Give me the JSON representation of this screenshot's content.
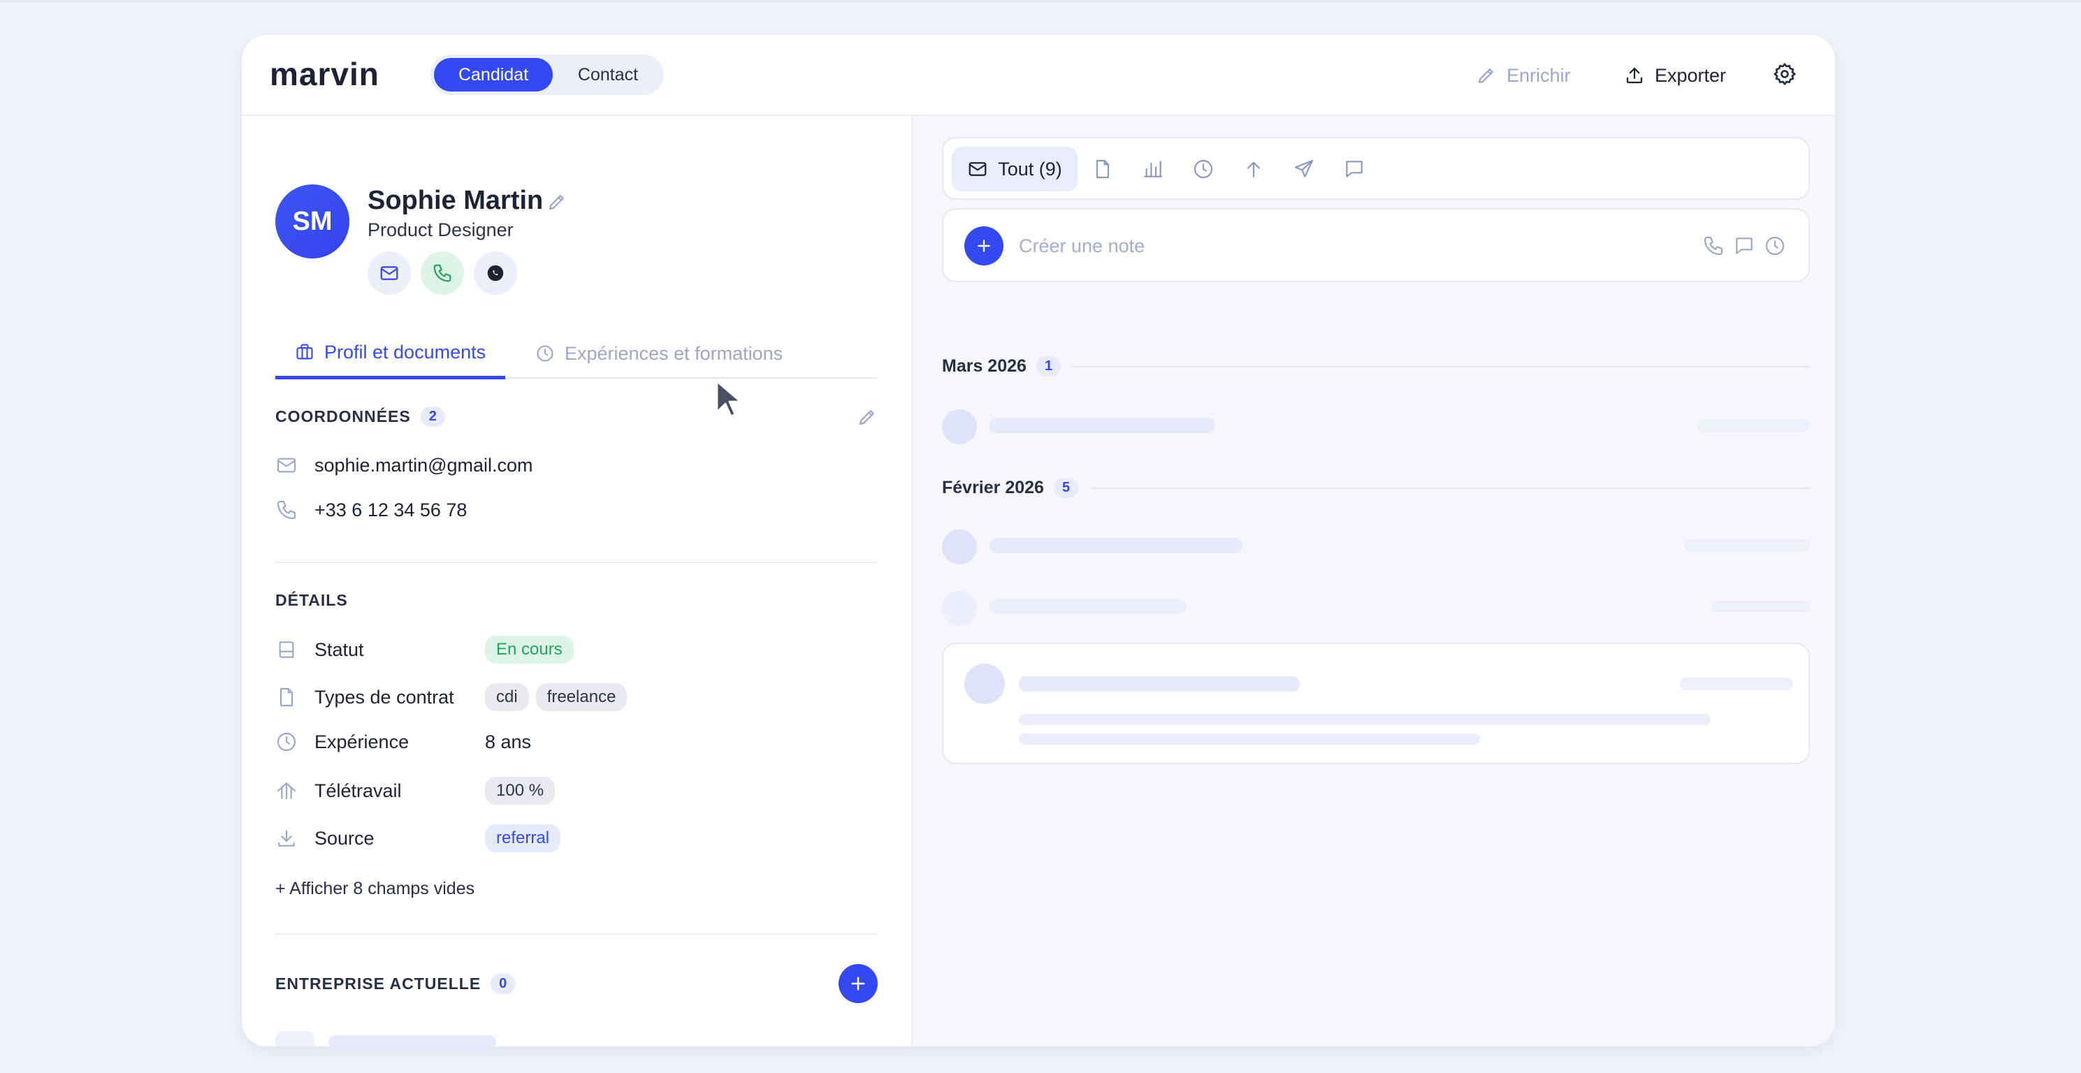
{
  "app": {
    "logo": "marvin",
    "toggle": [
      "Candidat",
      "Contact"
    ],
    "enrich_label": "Enrichir",
    "export_label": "Exporter",
    "colors": {
      "accent": "#3449f2",
      "success": "#27a35f",
      "muted": "#9ea6c6"
    }
  },
  "profile": {
    "initials": "SM",
    "name": "Sophie Martin",
    "title": "Product Designer"
  },
  "tabs": [
    {
      "label": "Profil et documents",
      "icon": "briefcase-icon"
    },
    {
      "label": "Expériences et formations",
      "icon": "clock-icon"
    }
  ],
  "coords": {
    "title": "COORDONNÉES",
    "count": "2",
    "email": "sophie.martin@gmail.com",
    "phone": "+33 6 12 34 56 78"
  },
  "details": {
    "title": "DÉTAILS",
    "statut_label": "Statut",
    "statut_value": "En cours",
    "contrat_label": "Types de contrat",
    "contrat_values": [
      "cdi",
      "freelance"
    ],
    "exp_label": "Expérience",
    "exp_value": "8 ans",
    "tele_label": "Télétravail",
    "tele_value": "100 %",
    "source_label": "Source",
    "source_value": "referral",
    "show_more": "+ Afficher 8 champs vides"
  },
  "company": {
    "title": "ENTREPRISE ACTUELLE",
    "count": "0"
  },
  "activity": {
    "filter_all": "Tout (9)",
    "note_placeholder": "Créer une note",
    "months": [
      {
        "label": "Mars 2026",
        "count": "1"
      },
      {
        "label": "Février 2026",
        "count": "5"
      }
    ]
  }
}
